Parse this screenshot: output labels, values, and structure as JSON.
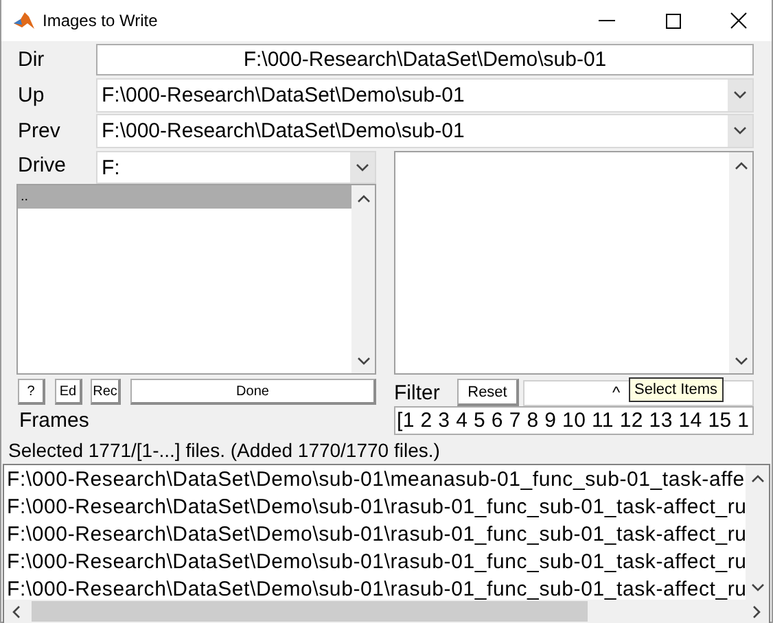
{
  "window": {
    "title": "Images to Write"
  },
  "dir": {
    "label": "Dir",
    "value": "F:\\000-Research\\DataSet\\Demo\\sub-01"
  },
  "up": {
    "label": "Up",
    "value": "F:\\000-Research\\DataSet\\Demo\\sub-01"
  },
  "prev": {
    "label": "Prev",
    "value": "F:\\000-Research\\DataSet\\Demo\\sub-01"
  },
  "drive": {
    "label": "Drive",
    "value": "F:"
  },
  "directories": [
    {
      "label": "..",
      "selected": true
    }
  ],
  "buttons": [
    {
      "label": "?"
    },
    {
      "label": "Ed"
    },
    {
      "label": "Rec"
    },
    {
      "label": "Done"
    }
  ],
  "filter": {
    "label": "Filter",
    "reset": "Reset",
    "value": "^"
  },
  "tooltip": "Select Items",
  "frames": {
    "label": "Frames",
    "value": "[1 2 3 4 5 6 7 8 9 10 11 12 13 14 15 1"
  },
  "status": "Selected 1771/[1-...] files. (Added 1770/1770 files.)",
  "selected_files": [
    "F:\\000-Research\\DataSet\\Demo\\sub-01\\meanasub-01_func_sub-01_task-affe",
    "F:\\000-Research\\DataSet\\Demo\\sub-01\\rasub-01_func_sub-01_task-affect_ru",
    "F:\\000-Research\\DataSet\\Demo\\sub-01\\rasub-01_func_sub-01_task-affect_ru",
    "F:\\000-Research\\DataSet\\Demo\\sub-01\\rasub-01_func_sub-01_task-affect_ru",
    "F:\\000-Research\\DataSet\\Demo\\sub-01\\rasub-01_func_sub-01_task-affect_ru"
  ]
}
